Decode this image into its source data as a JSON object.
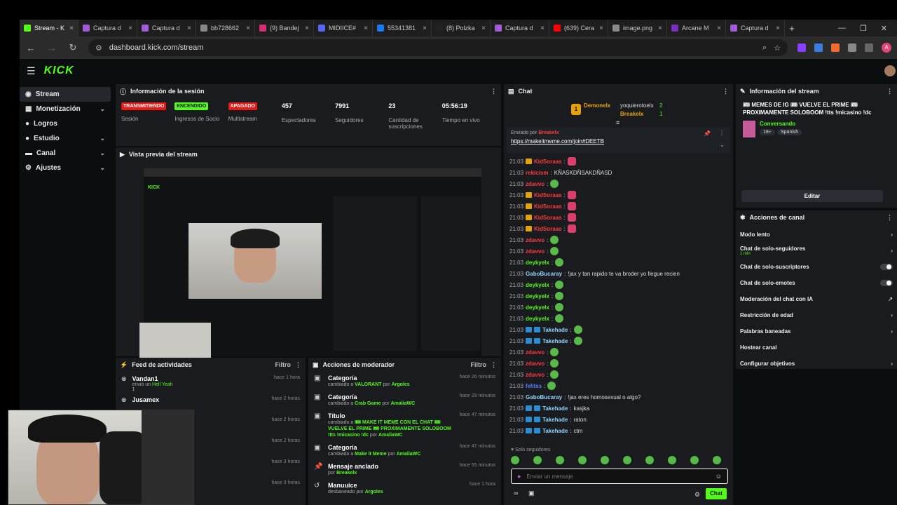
{
  "browser": {
    "tabs": [
      {
        "label": "Stream - K",
        "color": "#53fc18",
        "active": true
      },
      {
        "label": "Captura d",
        "color": "#a05cd6"
      },
      {
        "label": "Captura d",
        "color": "#a05cd6"
      },
      {
        "label": "bb728662",
        "color": "#888888"
      },
      {
        "label": "(9) Bandej",
        "color": "#d62976"
      },
      {
        "label": "MIDIICE#",
        "color": "#5865f2"
      },
      {
        "label": "55341381",
        "color": "#1877f2"
      },
      {
        "label": "(8) Polzka",
        "color": "#222222"
      },
      {
        "label": "Captura d",
        "color": "#a05cd6"
      },
      {
        "label": "(639) Cera",
        "color": "#ff0000"
      },
      {
        "label": "image.png",
        "color": "#888888"
      },
      {
        "label": "Arcane M",
        "color": "#7b2cbf"
      },
      {
        "label": "Captura d",
        "color": "#a05cd6"
      }
    ],
    "url": "dashboard.kick.com/stream",
    "profile_initial": "A"
  },
  "app": {
    "logo": "KICK",
    "sidebar": [
      {
        "label": "Stream",
        "icon": "stream-icon",
        "active": true,
        "chevron": false
      },
      {
        "label": "Monetización",
        "icon": "money-icon",
        "chevron": true
      },
      {
        "label": "Logros",
        "icon": "trophy-icon",
        "chevron": false
      },
      {
        "label": "Estudio",
        "icon": "studio-icon",
        "chevron": true
      },
      {
        "label": "Canal",
        "icon": "channel-icon",
        "chevron": true
      },
      {
        "label": "Ajustes",
        "icon": "gear-icon",
        "chevron": true
      }
    ]
  },
  "session": {
    "title": "Información de la sesión",
    "stats": [
      {
        "badge": "TRANSMITIENDO",
        "badge_color": "#e91916",
        "label": "Sesión"
      },
      {
        "badge": "ENCENDIDO",
        "badge_color": "#53fc18",
        "label": "Ingresos de Socio"
      },
      {
        "badge": "APAGADO",
        "badge_color": "#e91916",
        "label": "Multistream"
      },
      {
        "value": "457",
        "label": "Espectadores"
      },
      {
        "value": "7991",
        "label": "Seguidores"
      },
      {
        "value": "23",
        "label": "Cantidad de suscripciones"
      },
      {
        "value": "05:56:19",
        "label": "Tiempo en vivo"
      }
    ]
  },
  "preview": {
    "title": "Vista previa del stream"
  },
  "feed": {
    "title": "Feed de actividades",
    "filter": "Filtro",
    "items": [
      {
        "name": "Vandan1",
        "action": "envió un",
        "gift": "Hell Yeah",
        "count": "1",
        "time": "hace 1 hora"
      },
      {
        "name": "Jusamex",
        "action": "",
        "gift": "",
        "count": "",
        "time": "hace 2 horas"
      },
      {
        "name": "",
        "action": "",
        "gift": "",
        "count": "",
        "time": "hace 2 horas"
      },
      {
        "name": "",
        "action": "",
        "gift": "",
        "count": "",
        "time": "hace 2 horas"
      },
      {
        "name": "",
        "action": "",
        "gift": "",
        "count": "",
        "time": "hace 3 horas"
      },
      {
        "name": "",
        "action": "",
        "gift": "",
        "count": "",
        "time": "hace 3 horas"
      }
    ]
  },
  "modactions": {
    "title": "Acciones de moderador",
    "filter": "Filtro",
    "items": [
      {
        "title": "Categoría",
        "pre": "cambiado a",
        "val": "VALORANT",
        "mid": "por",
        "user": "Argoles",
        "time": "hace 26 minutos",
        "icon": "category-icon"
      },
      {
        "title": "Categoría",
        "pre": "cambiado a",
        "val": "Crab Game",
        "mid": "por",
        "user": "AmaliaWC",
        "time": "hace 29 minutos",
        "icon": "category-icon"
      },
      {
        "title": "Título",
        "pre": "cambiado a",
        "val": "🎟 MAKE IT MEME CON EL CHAT 🎟 VUELVE EL PRIME 🎟 PROXIMAMENTE SOLOBOOM !tts !micasino !dc",
        "mid": "por",
        "user": "AmaliaWC",
        "time": "hace 47 minutos",
        "icon": "title-icon"
      },
      {
        "title": "Categoría",
        "pre": "cambiado a",
        "val": "Make it Meme",
        "mid": "por",
        "user": "AmaliaWC",
        "time": "hace 47 minutos",
        "icon": "category-icon"
      },
      {
        "title": "Mensaje anclado",
        "pre": "por",
        "val": "Breakelx",
        "mid": "",
        "user": "",
        "time": "hace 55 minutos",
        "icon": "pin-icon"
      },
      {
        "title": "Manuuice",
        "pre": "desbaneado por",
        "val": "Argoles",
        "mid": "",
        "user": "",
        "time": "hace 1 hora",
        "icon": "unban-icon"
      }
    ]
  },
  "chat": {
    "title": "Chat",
    "leaderboard": [
      {
        "rank": "1",
        "name": "Demonelx",
        "score": ""
      },
      {
        "rank": "",
        "name": "yoquierotoelx",
        "score": "2"
      },
      {
        "rank": "",
        "name": "Breakelx",
        "score": "1"
      }
    ],
    "pinned_by": "Enviado por",
    "pinned_user": "Breakelx",
    "pinned_link": "https://makeitmeme.com/join#DEETB",
    "messages": [
      {
        "ts": "21:03",
        "name": "KidSoraas",
        "color": "#ff3a3a",
        "text": "",
        "emote": "pink",
        "crown": true
      },
      {
        "ts": "21:03",
        "name": "rekicism",
        "color": "#ff3a3a",
        "text": "KÑASKDÑSAKDÑASD",
        "emote": "",
        "crown": false
      },
      {
        "ts": "21:03",
        "name": "zdavvo",
        "color": "#ff3a3a",
        "text": "",
        "emote": "green",
        "crown": false
      },
      {
        "ts": "21:03",
        "name": "KidSoraas",
        "color": "#ff3a3a",
        "text": "",
        "emote": "pink",
        "crown": true
      },
      {
        "ts": "21:03",
        "name": "KidSoraas",
        "color": "#ff3a3a",
        "text": "",
        "emote": "pink",
        "crown": true
      },
      {
        "ts": "21:03",
        "name": "KidSoraas",
        "color": "#ff3a3a",
        "text": "",
        "emote": "pink",
        "crown": true
      },
      {
        "ts": "21:03",
        "name": "KidSoraas",
        "color": "#ff3a3a",
        "text": "",
        "emote": "pink",
        "crown": true
      },
      {
        "ts": "21:03",
        "name": "zdavvo",
        "color": "#ff3a3a",
        "text": "",
        "emote": "green",
        "crown": false
      },
      {
        "ts": "21:03",
        "name": "zdavvo",
        "color": "#ff3a3a",
        "text": "",
        "emote": "green",
        "crown": false
      },
      {
        "ts": "21:03",
        "name": "deykyelx",
        "color": "#53fc18",
        "text": "",
        "emote": "green",
        "crown": false
      },
      {
        "ts": "21:03",
        "name": "GaboBucaray",
        "color": "#8fd3ff",
        "text": "!jax y tan rapido te va broder yo llegue recien",
        "emote": "",
        "crown": false
      },
      {
        "ts": "21:03",
        "name": "deykyelx",
        "color": "#53fc18",
        "text": "",
        "emote": "green",
        "crown": false
      },
      {
        "ts": "21:03",
        "name": "deykyelx",
        "color": "#53fc18",
        "text": "",
        "emote": "green",
        "crown": false
      },
      {
        "ts": "21:03",
        "name": "deykyelx",
        "color": "#53fc18",
        "text": "",
        "emote": "green",
        "crown": false
      },
      {
        "ts": "21:03",
        "name": "deykyelx",
        "color": "#53fc18",
        "text": "",
        "emote": "green",
        "crown": false
      },
      {
        "ts": "21:03",
        "name": "Takehade",
        "color": "#8fd3ff",
        "text": "",
        "emote": "green",
        "crown": false
      },
      {
        "ts": "21:03",
        "name": "Takehade",
        "color": "#8fd3ff",
        "text": "",
        "emote": "green",
        "crown": false
      },
      {
        "ts": "21:03",
        "name": "zdavvo",
        "color": "#ff3a3a",
        "text": "",
        "emote": "green",
        "crown": false
      },
      {
        "ts": "21:03",
        "name": "zdavvo",
        "color": "#ff3a3a",
        "text": "",
        "emote": "green",
        "crown": false
      },
      {
        "ts": "21:03",
        "name": "zdavvo",
        "color": "#ff3a3a",
        "text": "",
        "emote": "green",
        "crown": false
      },
      {
        "ts": "21:03",
        "name": "felitss",
        "color": "#5b7cff",
        "text": "",
        "emote": "green",
        "crown": false
      },
      {
        "ts": "21:03",
        "name": "GaboBucaray",
        "color": "#8fd3ff",
        "text": "!jax eres homosexual o algo?",
        "emote": "",
        "crown": false
      },
      {
        "ts": "21:03",
        "name": "Takehade",
        "color": "#8fd3ff",
        "text": "kasjka",
        "emote": "",
        "crown": false
      },
      {
        "ts": "21:03",
        "name": "Takehade",
        "color": "#8fd3ff",
        "text": "raton",
        "emote": "",
        "crown": false
      },
      {
        "ts": "21:03",
        "name": "Takehade",
        "color": "#8fd3ff",
        "text": "ctm",
        "emote": "",
        "crown": false
      }
    ],
    "mode_label": "Solo seguidores",
    "input_placeholder": "Enviar un mensaje",
    "send_label": "Chat"
  },
  "stream_info": {
    "title": "Información del stream",
    "stream_title": "🎟 MEMES DE IG 🎟 VUELVE EL PRIME 🎟 PROXIMAMENTE SOLOBOOM !tts !micasino !dc",
    "category": "Conversando",
    "tags": [
      "18+",
      "Spanish"
    ],
    "edit_label": "Editar"
  },
  "channel_actions": {
    "title": "Acciones de canal",
    "items": [
      {
        "label": "Modo lento",
        "sub": "",
        "control": "chevron"
      },
      {
        "label": "Chat de solo-seguidores",
        "sub": "1 min",
        "control": "chevron"
      },
      {
        "label": "Chat de solo-suscriptores",
        "sub": "",
        "control": "toggle"
      },
      {
        "label": "Chat de solo-emotes",
        "sub": "",
        "control": "toggle"
      },
      {
        "label": "Moderación del chat con IA",
        "sub": "",
        "control": "external"
      },
      {
        "label": "Restricción de edad",
        "sub": "",
        "control": "chevron"
      },
      {
        "label": "Palabras baneadas",
        "sub": "",
        "control": "chevron"
      },
      {
        "label": "Hostear canal",
        "sub": "",
        "control": "none"
      },
      {
        "label": "Configurar objetivos",
        "sub": "",
        "control": "chevron"
      }
    ]
  }
}
